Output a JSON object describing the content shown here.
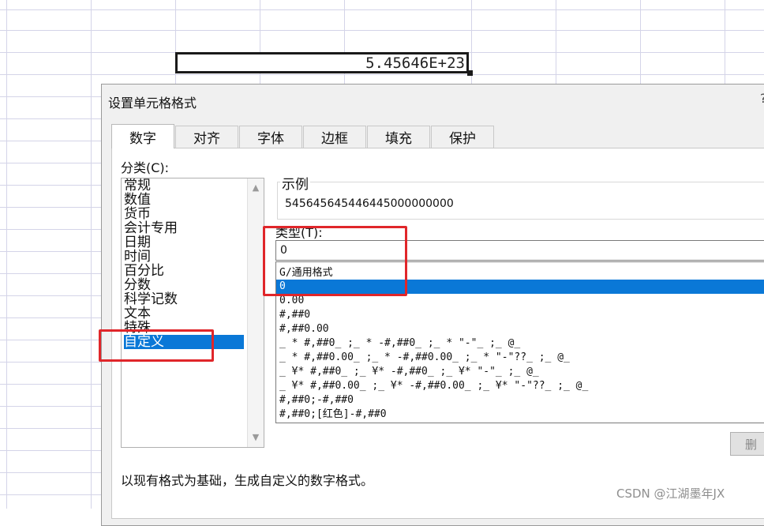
{
  "spreadsheet": {
    "active_cell_value": "5.45646E+23"
  },
  "dialog": {
    "title": "设置单元格格式",
    "help_button": "?",
    "tabs": [
      {
        "label": "数字",
        "active": true
      },
      {
        "label": "对齐",
        "active": false
      },
      {
        "label": "字体",
        "active": false
      },
      {
        "label": "边框",
        "active": false
      },
      {
        "label": "填充",
        "active": false
      },
      {
        "label": "保护",
        "active": false
      }
    ],
    "category_label": "分类(C):",
    "categories": [
      {
        "label": "常规",
        "selected": false
      },
      {
        "label": "数值",
        "selected": false
      },
      {
        "label": "货币",
        "selected": false
      },
      {
        "label": "会计专用",
        "selected": false
      },
      {
        "label": "日期",
        "selected": false
      },
      {
        "label": "时间",
        "selected": false
      },
      {
        "label": "百分比",
        "selected": false
      },
      {
        "label": "分数",
        "selected": false
      },
      {
        "label": "科学记数",
        "selected": false
      },
      {
        "label": "文本",
        "selected": false
      },
      {
        "label": "特殊",
        "selected": false
      },
      {
        "label": "自定义",
        "selected": true
      }
    ],
    "sample_label": "示例",
    "sample_value": "545645645446445000000000",
    "type_label": "类型(T):",
    "type_value": "0",
    "format_list": [
      {
        "label": "G/通用格式",
        "selected": false
      },
      {
        "label": "0",
        "selected": true
      },
      {
        "label": "0.00",
        "selected": false
      },
      {
        "label": "#,##0",
        "selected": false
      },
      {
        "label": "#,##0.00",
        "selected": false
      },
      {
        "label": "_ * #,##0_ ;_ * -#,##0_ ;_ * \"-\"_ ;_ @_",
        "selected": false
      },
      {
        "label": "_ * #,##0.00_ ;_ * -#,##0.00_ ;_ * \"-\"??_ ;_ @_",
        "selected": false
      },
      {
        "label": "_ ¥* #,##0_ ;_ ¥* -#,##0_ ;_ ¥* \"-\"_ ;_ @_",
        "selected": false
      },
      {
        "label": "_ ¥* #,##0.00_ ;_ ¥* -#,##0.00_ ;_ ¥* \"-\"??_ ;_ @_",
        "selected": false
      },
      {
        "label": "#,##0;-#,##0",
        "selected": false
      },
      {
        "label": "#,##0;[红色]-#,##0",
        "selected": false
      }
    ],
    "delete_button": "删",
    "description": "以现有格式为基础，生成自定义的数字格式。"
  },
  "watermark": "CSDN @江湖墨年JX",
  "colors": {
    "selection": "#0a78d7",
    "annotation_red": "#e0262a",
    "grid_line": "#d4d4e8"
  }
}
